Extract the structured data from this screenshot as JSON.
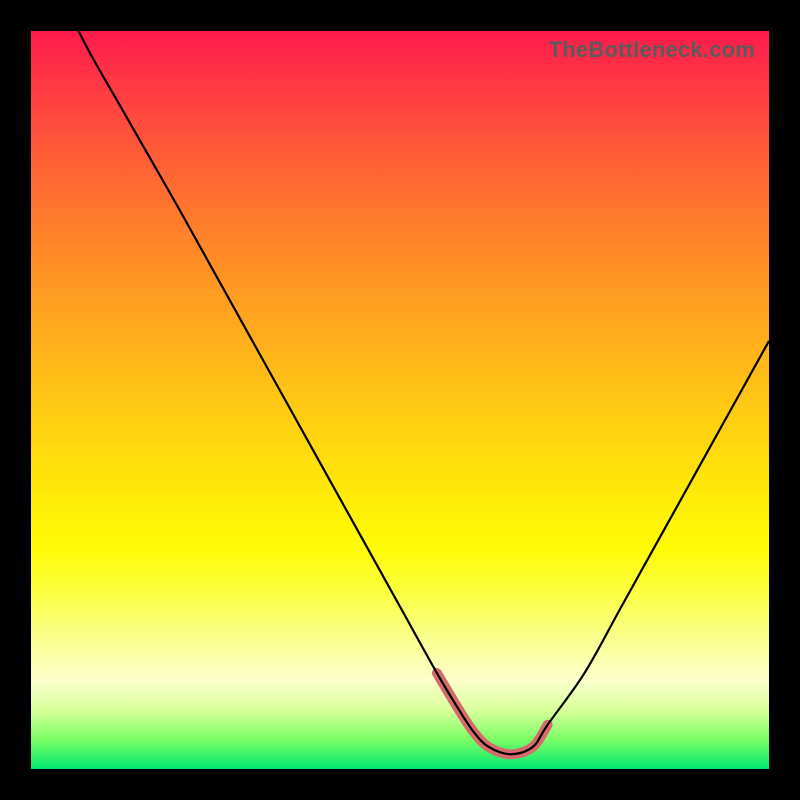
{
  "watermark": "TheBottleneck.com",
  "chart_data": {
    "type": "line",
    "title": "",
    "xlabel": "",
    "ylabel": "",
    "xlim": [
      0,
      100
    ],
    "ylim": [
      0,
      100
    ],
    "x": [
      0,
      2,
      5,
      8,
      12,
      16,
      20,
      25,
      30,
      35,
      40,
      45,
      50,
      55,
      58,
      60,
      62,
      65,
      68,
      70,
      75,
      80,
      85,
      90,
      95,
      100
    ],
    "values": [
      115,
      110,
      103,
      97,
      90,
      83,
      76,
      67,
      58,
      49,
      40,
      31,
      22,
      13,
      8,
      5,
      3,
      2,
      3,
      6,
      13,
      22,
      31,
      40,
      49,
      58
    ],
    "highlight_range_x": [
      55,
      72
    ],
    "colors": {
      "gradient_top": "#ff1a4d",
      "gradient_mid": "#ffe808",
      "gradient_bottom": "#00e86f",
      "curve": "#000000",
      "highlight": "#d76b6b",
      "frame": "#000000"
    }
  }
}
